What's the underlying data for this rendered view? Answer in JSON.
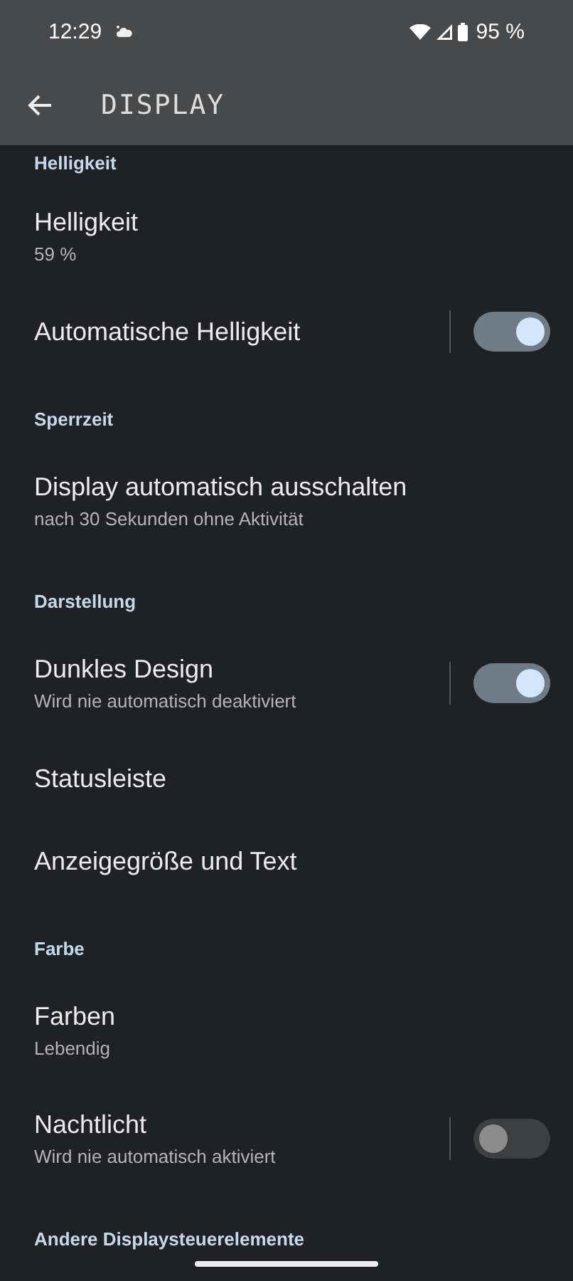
{
  "status_bar": {
    "time": "12:29",
    "battery": "95 %"
  },
  "app_bar": {
    "title": "DISPLAY"
  },
  "list": [
    {
      "kind": "section",
      "title": "Helligkeit"
    },
    {
      "kind": "item",
      "title": "Helligkeit",
      "subtitle": "59 %"
    },
    {
      "kind": "toggle",
      "title": "Automatische Helligkeit",
      "on": true
    },
    {
      "kind": "section",
      "title": "Sperrzeit"
    },
    {
      "kind": "item",
      "title": "Display automatisch ausschalten",
      "subtitle": "nach 30 Sekunden ohne Aktivität"
    },
    {
      "kind": "section",
      "title": "Darstellung"
    },
    {
      "kind": "toggle",
      "title": "Dunkles Design",
      "subtitle": "Wird nie automatisch deaktiviert",
      "on": true
    },
    {
      "kind": "item",
      "title": "Statusleiste"
    },
    {
      "kind": "item",
      "title": "Anzeigegröße und Text"
    },
    {
      "kind": "section",
      "title": "Farbe"
    },
    {
      "kind": "item",
      "title": "Farben",
      "subtitle": "Lebendig"
    },
    {
      "kind": "toggle",
      "title": "Nachtlicht",
      "subtitle": "Wird nie automatisch aktiviert",
      "on": false
    },
    {
      "kind": "section",
      "title": "Andere Displaysteuerelemente"
    }
  ]
}
